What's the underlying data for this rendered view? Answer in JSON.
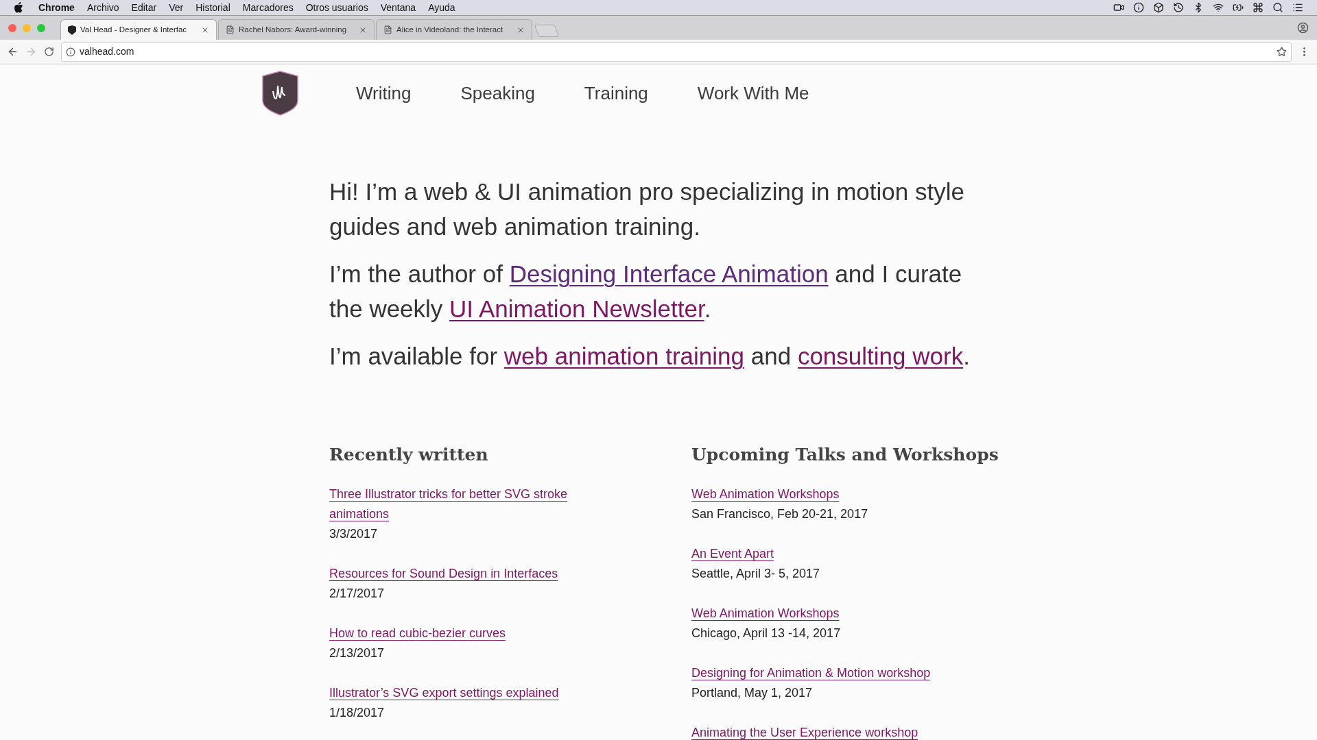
{
  "menu_bar": {
    "app": "Chrome",
    "items": [
      "Archivo",
      "Editar",
      "Ver",
      "Historial",
      "Marcadores",
      "Otros usuarios",
      "Ventana",
      "Ayuda"
    ]
  },
  "tabs": [
    {
      "label": "Val Head - Designer & Interfac",
      "selected": true,
      "kind": "site"
    },
    {
      "label": "Rachel Nabors: Award-winning",
      "selected": false,
      "kind": "page"
    },
    {
      "label": "Alice in Videoland: the Interact",
      "selected": false,
      "kind": "page"
    }
  ],
  "address_bar": {
    "value": "valhead.com"
  },
  "nav": [
    "Writing",
    "Speaking",
    "Training",
    "Work With Me"
  ],
  "intro": [
    [
      {
        "kind": "text",
        "text": "Hi! I’m a web & UI animation pro specializing in motion style guides and web animation training."
      }
    ],
    [
      {
        "kind": "text",
        "text": "I’m the author of "
      },
      {
        "kind": "link",
        "text": "Designing Interface Animation",
        "visited": true
      },
      {
        "kind": "text",
        "text": " and I curate the weekly "
      },
      {
        "kind": "link",
        "text": "UI Animation Newsletter",
        "visited": false
      },
      {
        "kind": "text",
        "text": "."
      }
    ],
    [
      {
        "kind": "text",
        "text": "I’m available for "
      },
      {
        "kind": "link",
        "text": "web animation training",
        "visited": false
      },
      {
        "kind": "text",
        "text": " and "
      },
      {
        "kind": "link",
        "text": "consulting work",
        "visited": false
      },
      {
        "kind": "text",
        "text": "."
      }
    ]
  ],
  "recently_written": {
    "title": "Recently written",
    "posts": [
      {
        "title": "Three Illustrator tricks for better SVG stroke animations",
        "date": "3/3/2017"
      },
      {
        "title": "Resources for Sound Design in Interfaces",
        "date": "2/17/2017"
      },
      {
        "title": "How to read cubic-bezier curves",
        "date": "2/13/2017"
      },
      {
        "title": "Illustrator’s SVG export settings explained",
        "date": "1/18/2017"
      }
    ]
  },
  "upcoming": {
    "title": "Upcoming Talks and Workshops",
    "events": [
      {
        "title": "Web Animation Workshops",
        "detail": "San Francisco, Feb 20-21, 2017"
      },
      {
        "title": "An Event Apart",
        "detail": "Seattle, April 3- 5, 2017"
      },
      {
        "title": "Web Animation Workshops",
        "detail": "Chicago, April 13 -14, 2017"
      },
      {
        "title": "Designing for Animation & Motion workshop",
        "detail": "Portland, May 1, 2017"
      },
      {
        "title": "Animating the User Experience workshop"
      }
    ]
  }
}
